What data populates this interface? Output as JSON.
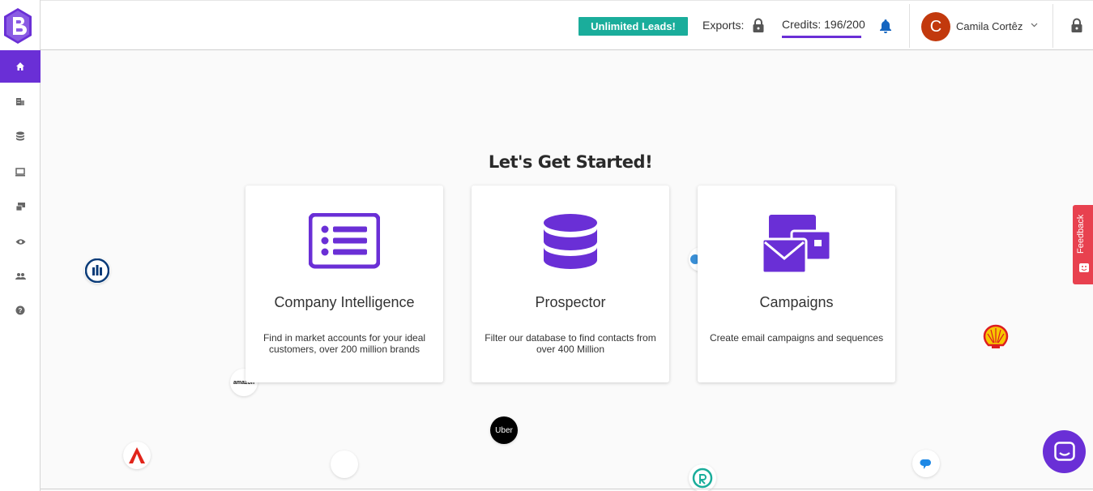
{
  "header": {
    "unlimited_label": "Unlimited Leads!",
    "exports_label": "Exports:",
    "credits_label": "Credits: 196/200",
    "user_initial": "C",
    "user_name": "Camila Cortêz"
  },
  "sidebar": {
    "items": [
      {
        "icon": "home-icon",
        "active": true
      },
      {
        "icon": "company-icon",
        "active": false
      },
      {
        "icon": "database-icon",
        "active": false
      },
      {
        "icon": "monitor-icon",
        "active": false
      },
      {
        "icon": "campaign-icon",
        "active": false
      },
      {
        "icon": "eye-icon",
        "active": false
      },
      {
        "icon": "people-icon",
        "active": false
      },
      {
        "icon": "help-icon",
        "active": false
      }
    ]
  },
  "main": {
    "title": "Let's Get Started!",
    "cards": [
      {
        "title": "Company Intelligence",
        "desc": "Find in market accounts for your ideal customers, over 200 million brands",
        "icon": "list-icon"
      },
      {
        "title": "Prospector",
        "desc": "Filter our database to find contacts from over 400 Million",
        "icon": "database-icon"
      },
      {
        "title": "Campaigns",
        "desc": "Create email campaigns and sequences",
        "icon": "mail-icon"
      }
    ]
  },
  "logos": {
    "uber": "Uber",
    "amazon": "amazon"
  },
  "feedback_label": "Feedback",
  "colors": {
    "accent": "#6a2fd6",
    "teal": "#1aad9b",
    "avatar": "#c2390d",
    "feedback": "#e8414f"
  }
}
